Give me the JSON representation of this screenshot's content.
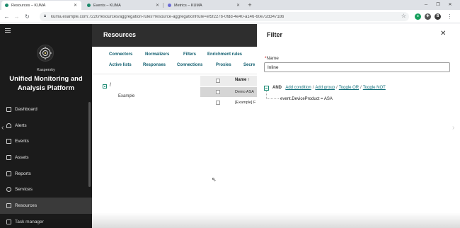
{
  "browser": {
    "tabs": [
      {
        "title": "Resources – KUMA"
      },
      {
        "title": "Events – KUMA"
      },
      {
        "title": "Metrics – KUMA"
      }
    ],
    "new_tab": "+",
    "url": "kuma.example.com:7220/resources/aggregation-rules?resource-aggregationRule=ef5f2276-0fdd-4e40-a146-60e72d347186",
    "profile_initial": "B"
  },
  "sidebar": {
    "vendor": "Kaspersky",
    "product_line1": "Unified Monitoring and",
    "product_line2": "Analysis Platform",
    "items": [
      {
        "label": "Dashboard",
        "active": false
      },
      {
        "label": "Alerts",
        "active": false
      },
      {
        "label": "Events",
        "active": false
      },
      {
        "label": "Assets",
        "active": false
      },
      {
        "label": "Reports",
        "active": false
      },
      {
        "label": "Services",
        "active": false
      },
      {
        "label": "Resources",
        "active": true
      },
      {
        "label": "Task manager",
        "active": false
      }
    ]
  },
  "resources": {
    "title": "Resources",
    "tabs": [
      "Connectors",
      "Normalizers",
      "Filters",
      "Enrichment rules",
      "Active lists",
      "Responses",
      "Connections",
      "Proxies",
      "Secre"
    ],
    "tree": {
      "root": "/",
      "child": "Example"
    },
    "grid": {
      "column_name": "Name ↑",
      "rows": [
        "Demo ASA",
        "[Example] F"
      ]
    }
  },
  "filter": {
    "title": "Filter",
    "close": "✕",
    "name_label": "Name",
    "name_required_mark": "*",
    "name_value": "Inline",
    "operator": "AND",
    "actions": [
      "Add condition",
      "Add group",
      "Toggle OR",
      "Toggle NOT"
    ],
    "condition": "event.DeviceProduct = ASA"
  },
  "colors": {
    "sidebar_bg": "#1b1b1b",
    "header_bg": "#2e2e2e",
    "accent": "#0f5d6e",
    "tree_green": "#1a8a73"
  }
}
